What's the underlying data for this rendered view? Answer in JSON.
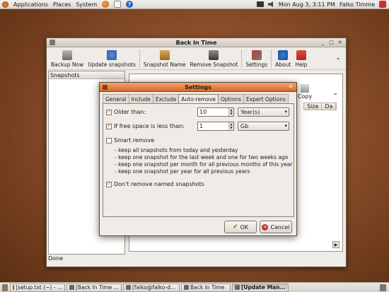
{
  "top_panel": {
    "menus": [
      "Applications",
      "Places",
      "System"
    ],
    "datetime": "Mon Aug  3,  3:11 PM",
    "user": "Falko Timme"
  },
  "main_window": {
    "title": "Back In Time",
    "toolbar": [
      {
        "label": "Backup Now",
        "icon": "backup-icon"
      },
      {
        "label": "Update snapshots",
        "icon": "refresh-icon"
      },
      {
        "label": "Snapshot Name",
        "icon": "snapshot-name-icon"
      },
      {
        "label": "Remove Snapshot",
        "icon": "trash-icon"
      },
      {
        "label": "Settings",
        "icon": "settings-icon"
      },
      {
        "label": "About",
        "icon": "info-icon"
      },
      {
        "label": "Help",
        "icon": "help-icon"
      }
    ],
    "snapshots_header": "Snapshots",
    "copy_label": "Copy",
    "file_columns": [
      "Size",
      "Da"
    ],
    "status": "Done"
  },
  "settings_dialog": {
    "title": "Settings",
    "tabs": [
      "General",
      "Include",
      "Exclude",
      "Auto-remove",
      "Options",
      "Expert Options"
    ],
    "active_tab": "Auto-remove",
    "older_than": {
      "label": "Older than:",
      "checked": true,
      "value": "10",
      "unit": "Year(s)"
    },
    "free_space": {
      "label": "If free space is less than:",
      "checked": true,
      "value": "1",
      "unit": "Gb"
    },
    "smart_remove": {
      "label": "Smart remove",
      "checked": false
    },
    "smart_rules": [
      "- keep all snapshots from today and yesterday",
      "- keep one snapshot for the last week and one for two weeks ago",
      "- keep one snapshot per month for all previous months of this year",
      "- keep one snapshot per year for all previous years"
    ],
    "dont_remove_named": {
      "label": "Don't remove named snapshots",
      "checked": true
    },
    "ok_label": "OK",
    "cancel_label": "Cancel"
  },
  "taskbar": {
    "tasks": [
      {
        "label": "[setup.txt (~) - ...",
        "active": false
      },
      {
        "label": "[Back In Time ...",
        "active": false
      },
      {
        "label": "[falko@falko-d...",
        "active": false
      },
      {
        "label": "Back In Time",
        "active": false
      },
      {
        "label": "[Update Man...",
        "active": true
      }
    ]
  }
}
